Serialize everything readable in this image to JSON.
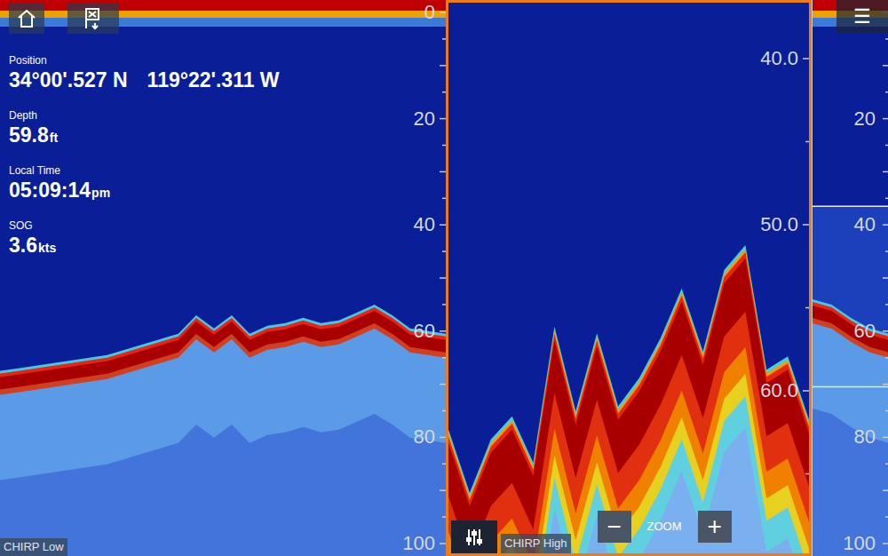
{
  "panels": [
    {
      "mode": "CHIRP Low",
      "active": false,
      "scale": [
        "0",
        "20",
        "40",
        "60",
        "80",
        "100"
      ],
      "bottom_profile": [
        68,
        67.5,
        67,
        66.5,
        66,
        65.5,
        65,
        64,
        63,
        62,
        61,
        57.5,
        60,
        57.5,
        61,
        59.5,
        59,
        58,
        59,
        58.5,
        57,
        55.5,
        57.5,
        60,
        60.5,
        61
      ]
    },
    {
      "mode": "CHIRP High",
      "active": true,
      "scale": [
        "40.0",
        "50.0",
        "60.0"
      ],
      "bottom_profile": [
        62.6,
        66.4,
        63.2,
        61.8,
        64.6,
        56.4,
        61.5,
        56.8,
        61.2,
        59.5,
        57.1,
        54.1,
        57.9,
        53.0,
        51.5,
        59.0,
        58.2,
        62.0
      ]
    },
    {
      "mode": "",
      "active": false,
      "scale": [
        "20",
        "40",
        "60",
        "80",
        "100"
      ],
      "bottom_profile": [
        54.5,
        55.5,
        58,
        60,
        61
      ],
      "zoom_window": {
        "from": 36.5,
        "to": 70.5
      }
    }
  ],
  "readouts": [
    {
      "label": "Position",
      "parts": [
        {
          "text": "34°00'.527 N",
          "kind": "value"
        },
        {
          "text": "119°22'.311 W",
          "kind": "value"
        }
      ]
    },
    {
      "label": "Depth",
      "parts": [
        {
          "text": "59.8",
          "kind": "value"
        },
        {
          "text": "ft",
          "kind": "unit"
        }
      ]
    },
    {
      "label": "Local Time",
      "parts": [
        {
          "text": "05:09:14",
          "kind": "value"
        },
        {
          "text": "pm",
          "kind": "unit"
        }
      ]
    },
    {
      "label": "SOG",
      "parts": [
        {
          "text": "3.6",
          "kind": "value"
        },
        {
          "text": "kts",
          "kind": "unit"
        }
      ]
    }
  ],
  "zoom": {
    "label": "ZOOM",
    "minus": "−",
    "plus": "+"
  },
  "menu_icon": "☰"
}
